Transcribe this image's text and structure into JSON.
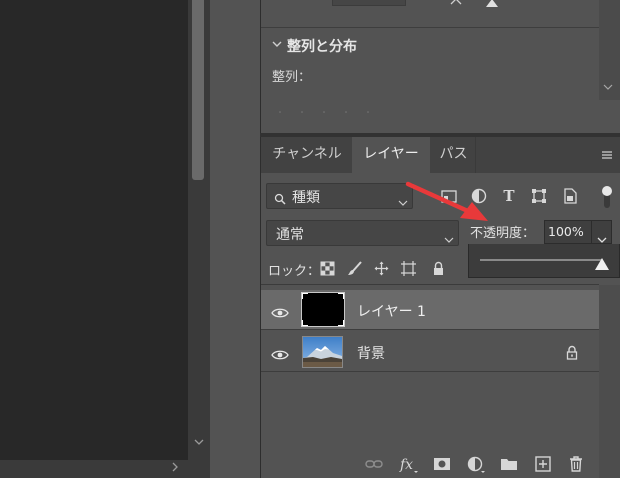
{
  "properties": {
    "align_section_title": "整列と分布",
    "align_label": "整列："
  },
  "layers_panel": {
    "tabs": [
      {
        "label": "チャンネル"
      },
      {
        "label": "レイヤー"
      },
      {
        "label": "パス"
      }
    ],
    "active_tab": "レイヤー",
    "filter": {
      "label": "種類"
    },
    "blend_mode": "通常",
    "opacity_label": "不透明度：",
    "opacity_value": "100%",
    "opacity_fraction": 1.0,
    "lock_label": "ロック：",
    "layers": [
      {
        "name": "レイヤー 1",
        "visible": true,
        "selected": true,
        "thumbnail": "black"
      },
      {
        "name": "背景",
        "visible": true,
        "selected": false,
        "locked": true,
        "thumbnail": "mountain-photo"
      }
    ],
    "footer_icons": [
      "link-icon",
      "fx-icon",
      "mask-icon",
      "adjustment-layer-icon",
      "group-folder-icon",
      "new-layer-icon",
      "trash-icon"
    ]
  },
  "colors": {
    "panel_bg": "#535353",
    "canvas_bg": "#282828",
    "selected_row": "#6a6a6a",
    "annotation_red": "#e8393a"
  }
}
